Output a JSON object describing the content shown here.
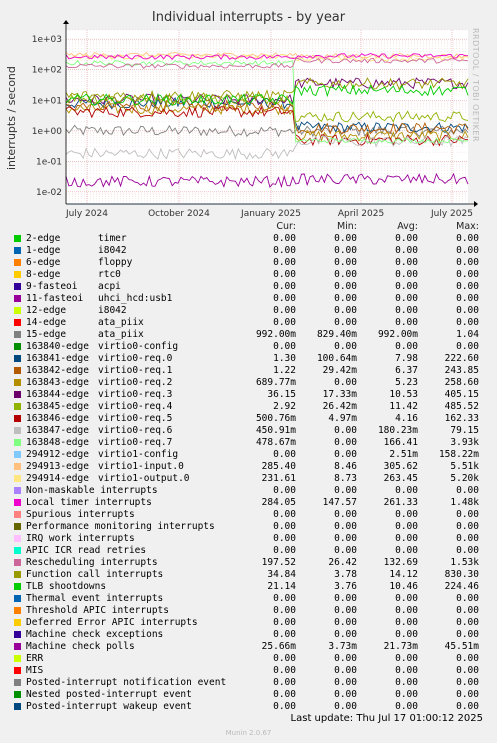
{
  "title": "Individual interrupts - by year",
  "ylabel": "interrupts / second",
  "right_label": "RRDTOOL / TOBI OETIKER",
  "columns": [
    "Cur:",
    "Min:",
    "Avg:",
    "Max:"
  ],
  "last_update": "Last update:  Thu Jul 17 01:00:12 2025",
  "munin": "Munin 2.0.67",
  "chart_data": {
    "type": "line",
    "title": "Individual interrupts - by year",
    "ylabel": "interrupts / second",
    "yscale": "log",
    "ylim": [
      0.004,
      2000
    ],
    "yticks": [
      0.01,
      0.1,
      1,
      10,
      100,
      1000
    ],
    "ytick_labels": [
      "1e-02",
      "1e-01",
      "1e+00",
      "1e+01",
      "1e+02",
      "1e+03"
    ],
    "xlim": [
      "2024-06-10",
      "2025-07-17"
    ],
    "xticks": [
      "2024-07-01",
      "2024-10-01",
      "2025-01-01",
      "2025-04-01",
      "2025-07-01"
    ],
    "xtick_labels": [
      "July 2024",
      "October 2024",
      "January 2025",
      "April 2025",
      "July 2025"
    ],
    "break_date": "2025-01-25",
    "grid": true,
    "legend_position": "below",
    "series": [
      {
        "name": "2-edge",
        "desc": "timer",
        "color": "#00cc00",
        "cur": "0.00",
        "min": "0.00",
        "avg": "0.00",
        "max": "0.00"
      },
      {
        "name": "1-edge",
        "desc": "i8042",
        "color": "#0066b3",
        "cur": "0.00",
        "min": "0.00",
        "avg": "0.00",
        "max": "0.00"
      },
      {
        "name": "6-edge",
        "desc": "floppy",
        "color": "#ff8000",
        "cur": "0.00",
        "min": "0.00",
        "avg": "0.00",
        "max": "0.00"
      },
      {
        "name": "8-edge",
        "desc": "rtc0",
        "color": "#ffcc00",
        "cur": "0.00",
        "min": "0.00",
        "avg": "0.00",
        "max": "0.00"
      },
      {
        "name": "9-fasteoi",
        "desc": "acpi",
        "color": "#330099",
        "cur": "0.00",
        "min": "0.00",
        "avg": "0.00",
        "max": "0.00"
      },
      {
        "name": "11-fasteoi",
        "desc": "uhci_hcd:usb1",
        "color": "#990099",
        "cur": "0.00",
        "min": "0.00",
        "avg": "0.00",
        "max": "0.00"
      },
      {
        "name": "12-edge",
        "desc": "i8042",
        "color": "#ccff00",
        "cur": "0.00",
        "min": "0.00",
        "avg": "0.00",
        "max": "0.00"
      },
      {
        "name": "14-edge",
        "desc": "ata_piix",
        "color": "#ff0000",
        "cur": "0.00",
        "min": "0.00",
        "avg": "0.00",
        "max": "0.00"
      },
      {
        "name": "15-edge",
        "desc": "ata_piix",
        "color": "#808080",
        "cur": "992.00m",
        "min": "829.40m",
        "avg": "992.00m",
        "max": "1.04"
      },
      {
        "name": "163840-edge",
        "desc": "virtio0-config",
        "color": "#008f00",
        "cur": "0.00",
        "min": "0.00",
        "avg": "0.00",
        "max": "0.00"
      },
      {
        "name": "163841-edge",
        "desc": "virtio0-req.0",
        "color": "#00487d",
        "cur": "1.30",
        "min": "100.64m",
        "avg": "7.98",
        "max": "222.60"
      },
      {
        "name": "163842-edge",
        "desc": "virtio0-req.1",
        "color": "#b35a00",
        "cur": "1.22",
        "min": "29.42m",
        "avg": "6.37",
        "max": "243.85"
      },
      {
        "name": "163843-edge",
        "desc": "virtio0-req.2",
        "color": "#b38f00",
        "cur": "689.77m",
        "min": "0.00",
        "avg": "5.23",
        "max": "258.60"
      },
      {
        "name": "163844-edge",
        "desc": "virtio0-req.3",
        "color": "#6b006b",
        "cur": "36.15",
        "min": "17.33m",
        "avg": "10.53",
        "max": "405.15"
      },
      {
        "name": "163845-edge",
        "desc": "virtio0-req.4",
        "color": "#8fb300",
        "cur": "2.92",
        "min": "26.42m",
        "avg": "11.42",
        "max": "485.52"
      },
      {
        "name": "163846-edge",
        "desc": "virtio0-req.5",
        "color": "#b30000",
        "cur": "500.76m",
        "min": "4.97m",
        "avg": "4.16",
        "max": "162.33"
      },
      {
        "name": "163847-edge",
        "desc": "virtio0-req.6",
        "color": "#bebebe",
        "cur": "450.91m",
        "min": "0.00",
        "avg": "180.23m",
        "max": "79.15"
      },
      {
        "name": "163848-edge",
        "desc": "virtio0-req.7",
        "color": "#80ff80",
        "cur": "478.67m",
        "min": "0.00",
        "avg": "166.41",
        "max": "3.93k"
      },
      {
        "name": "294912-edge",
        "desc": "virtio1-config",
        "color": "#80c9ff",
        "cur": "0.00",
        "min": "0.00",
        "avg": "2.51m",
        "max": "158.22m"
      },
      {
        "name": "294913-edge",
        "desc": "virtio1-input.0",
        "color": "#ffc080",
        "cur": "285.40",
        "min": "8.46",
        "avg": "305.62",
        "max": "5.51k"
      },
      {
        "name": "294914-edge",
        "desc": "virtio1-output.0",
        "color": "#ffe680",
        "cur": "231.61",
        "min": "8.73",
        "avg": "263.45",
        "max": "5.20k"
      },
      {
        "name": "Non-maskable interrupts",
        "desc": "",
        "color": "#aa80ff",
        "cur": "0.00",
        "min": "0.00",
        "avg": "0.00",
        "max": "0.00"
      },
      {
        "name": "Local timer interrupts",
        "desc": "",
        "color": "#ee00cc",
        "cur": "284.05",
        "min": "147.57",
        "avg": "261.33",
        "max": "1.48k"
      },
      {
        "name": "Spurious interrupts",
        "desc": "",
        "color": "#ff8080",
        "cur": "0.00",
        "min": "0.00",
        "avg": "0.00",
        "max": "0.00"
      },
      {
        "name": "Performance monitoring interrupts",
        "desc": "",
        "color": "#666600",
        "cur": "0.00",
        "min": "0.00",
        "avg": "0.00",
        "max": "0.00"
      },
      {
        "name": "IRQ work interrupts",
        "desc": "",
        "color": "#ffbfff",
        "cur": "0.00",
        "min": "0.00",
        "avg": "0.00",
        "max": "0.00"
      },
      {
        "name": "APIC ICR read retries",
        "desc": "",
        "color": "#00ffcc",
        "cur": "0.00",
        "min": "0.00",
        "avg": "0.00",
        "max": "0.00"
      },
      {
        "name": "Rescheduling interrupts",
        "desc": "",
        "color": "#cc6699",
        "cur": "197.52",
        "min": "26.42",
        "avg": "132.69",
        "max": "1.53k"
      },
      {
        "name": "Function call interrupts",
        "desc": "",
        "color": "#999900",
        "cur": "34.84",
        "min": "3.78",
        "avg": "14.12",
        "max": "830.30"
      },
      {
        "name": "TLB shootdowns",
        "desc": "",
        "color": "#00cc00",
        "cur": "21.14",
        "min": "3.76",
        "avg": "10.46",
        "max": "224.46"
      },
      {
        "name": "Thermal event interrupts",
        "desc": "",
        "color": "#0066b3",
        "cur": "0.00",
        "min": "0.00",
        "avg": "0.00",
        "max": "0.00"
      },
      {
        "name": "Threshold APIC interrupts",
        "desc": "",
        "color": "#ff8000",
        "cur": "0.00",
        "min": "0.00",
        "avg": "0.00",
        "max": "0.00"
      },
      {
        "name": "Deferred Error APIC interrupts",
        "desc": "",
        "color": "#ffcc00",
        "cur": "0.00",
        "min": "0.00",
        "avg": "0.00",
        "max": "0.00"
      },
      {
        "name": "Machine check exceptions",
        "desc": "",
        "color": "#330099",
        "cur": "0.00",
        "min": "0.00",
        "avg": "0.00",
        "max": "0.00"
      },
      {
        "name": "Machine check polls",
        "desc": "",
        "color": "#990099",
        "cur": "25.66m",
        "min": "3.73m",
        "avg": "21.73m",
        "max": "45.51m"
      },
      {
        "name": "ERR",
        "desc": "",
        "color": "#ccff00",
        "cur": "0.00",
        "min": "0.00",
        "avg": "0.00",
        "max": "0.00"
      },
      {
        "name": "MIS",
        "desc": "",
        "color": "#ff0000",
        "cur": "0.00",
        "min": "0.00",
        "avg": "0.00",
        "max": "0.00"
      },
      {
        "name": "Posted-interrupt notification event",
        "desc": "",
        "color": "#808080",
        "cur": "0.00",
        "min": "0.00",
        "avg": "0.00",
        "max": "0.00"
      },
      {
        "name": "Nested posted-interrupt event",
        "desc": "",
        "color": "#008f00",
        "cur": "0.00",
        "min": "0.00",
        "avg": "0.00",
        "max": "0.00"
      },
      {
        "name": "Posted-interrupt wakeup event",
        "desc": "",
        "color": "#00487d",
        "cur": "0.00",
        "min": "0.00",
        "avg": "0.00",
        "max": "0.00"
      }
    ]
  }
}
